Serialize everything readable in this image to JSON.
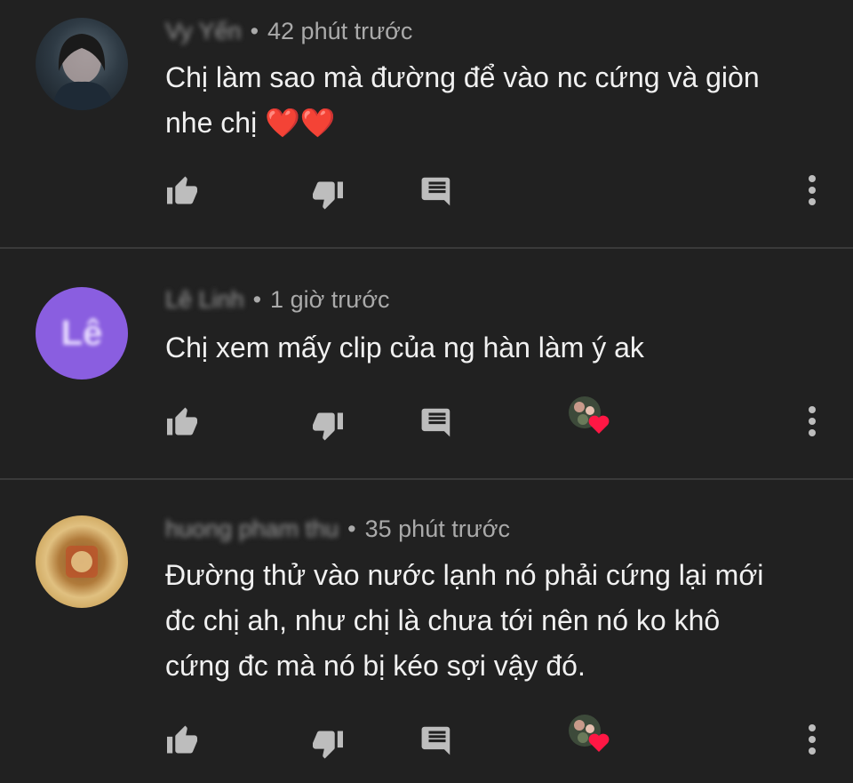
{
  "comments": [
    {
      "author": "Vy Yến",
      "time": "42 phút trước",
      "text_lines": [
        "Chị làm sao mà đường để vào nc cứng và giòn",
        "nhe chị ❤️❤️"
      ],
      "avatar_icon": "user-photo-avatar",
      "creator_heart": false
    },
    {
      "author": "Lê Linh",
      "time": "1 giờ trước",
      "text_lines": [
        "Chị xem mấy clip của ng hàn làm ý ak"
      ],
      "avatar_initials": "Lê",
      "avatar_color": "#8a5ee0",
      "creator_heart": true
    },
    {
      "author": "huong pham thu",
      "time": "35 phút trước",
      "text_lines": [
        "Đường thử vào nước lạnh nó phải cứng lại mới",
        "đc chị ah, như chị là chưa tới nên nó ko khô",
        "cứng đc mà nó bị kéo sợi vậy đó."
      ],
      "avatar_icon": "user-photo-avatar",
      "creator_heart": true
    }
  ],
  "separator": "•",
  "colors": {
    "background": "#212121",
    "meta": "#aaaaaa",
    "icon": "#bdbdbd",
    "heart": "#ff1744"
  }
}
